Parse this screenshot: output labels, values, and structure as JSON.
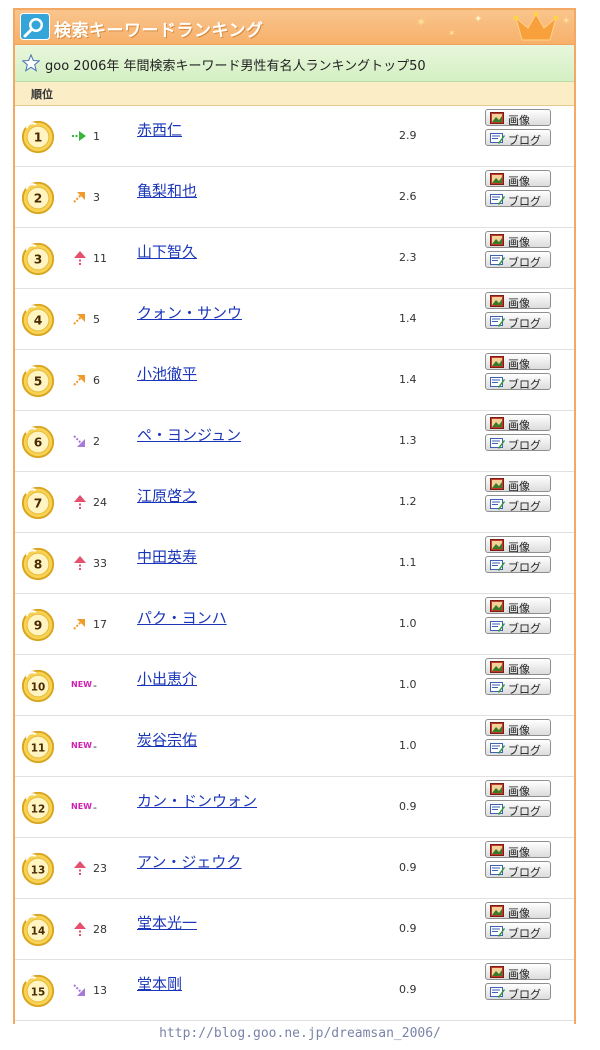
{
  "header": {
    "title": "検索キーワードランキング"
  },
  "subheader": {
    "title": "goo 2006年 年間検索キーワード男性有名人ランキングトップ50"
  },
  "columns": {
    "rank": "順位"
  },
  "buttons": {
    "image": "画像",
    "blog": "ブログ"
  },
  "colors": {
    "accent": "#f3a964",
    "link": "#1b36b8",
    "new": "#d01fb2"
  },
  "rows": [
    {
      "rank": "1",
      "trend": "same",
      "prev": "1",
      "name": "赤西仁",
      "score": "2.9"
    },
    {
      "rank": "2",
      "trend": "up",
      "prev": "3",
      "name": "亀梨和也",
      "score": "2.6"
    },
    {
      "rank": "3",
      "trend": "up-big",
      "prev": "11",
      "name": "山下智久",
      "score": "2.3"
    },
    {
      "rank": "4",
      "trend": "up",
      "prev": "5",
      "name": "クォン・サンウ",
      "score": "1.4"
    },
    {
      "rank": "5",
      "trend": "up",
      "prev": "6",
      "name": "小池徹平",
      "score": "1.4"
    },
    {
      "rank": "6",
      "trend": "down",
      "prev": "2",
      "name": "ペ・ヨンジュン",
      "score": "1.3"
    },
    {
      "rank": "7",
      "trend": "up-big",
      "prev": "24",
      "name": "江原啓之",
      "score": "1.2"
    },
    {
      "rank": "8",
      "trend": "up-big",
      "prev": "33",
      "name": "中田英寿",
      "score": "1.1"
    },
    {
      "rank": "9",
      "trend": "up",
      "prev": "17",
      "name": "パク・ヨンハ",
      "score": "1.0"
    },
    {
      "rank": "10",
      "trend": "new",
      "prev": "-",
      "name": "小出恵介",
      "score": "1.0"
    },
    {
      "rank": "11",
      "trend": "new",
      "prev": "-",
      "name": "炭谷宗佑",
      "score": "1.0"
    },
    {
      "rank": "12",
      "trend": "new",
      "prev": "-",
      "name": "カン・ドンウォン",
      "score": "0.9"
    },
    {
      "rank": "13",
      "trend": "up-big",
      "prev": "23",
      "name": "アン・ジェウク",
      "score": "0.9"
    },
    {
      "rank": "14",
      "trend": "up-big",
      "prev": "28",
      "name": "堂本光一",
      "score": "0.9"
    },
    {
      "rank": "15",
      "trend": "down",
      "prev": "13",
      "name": "堂本剛",
      "score": "0.9"
    }
  ],
  "footer": {
    "url": "http://blog.goo.ne.jp/dreamsan_2006/"
  }
}
